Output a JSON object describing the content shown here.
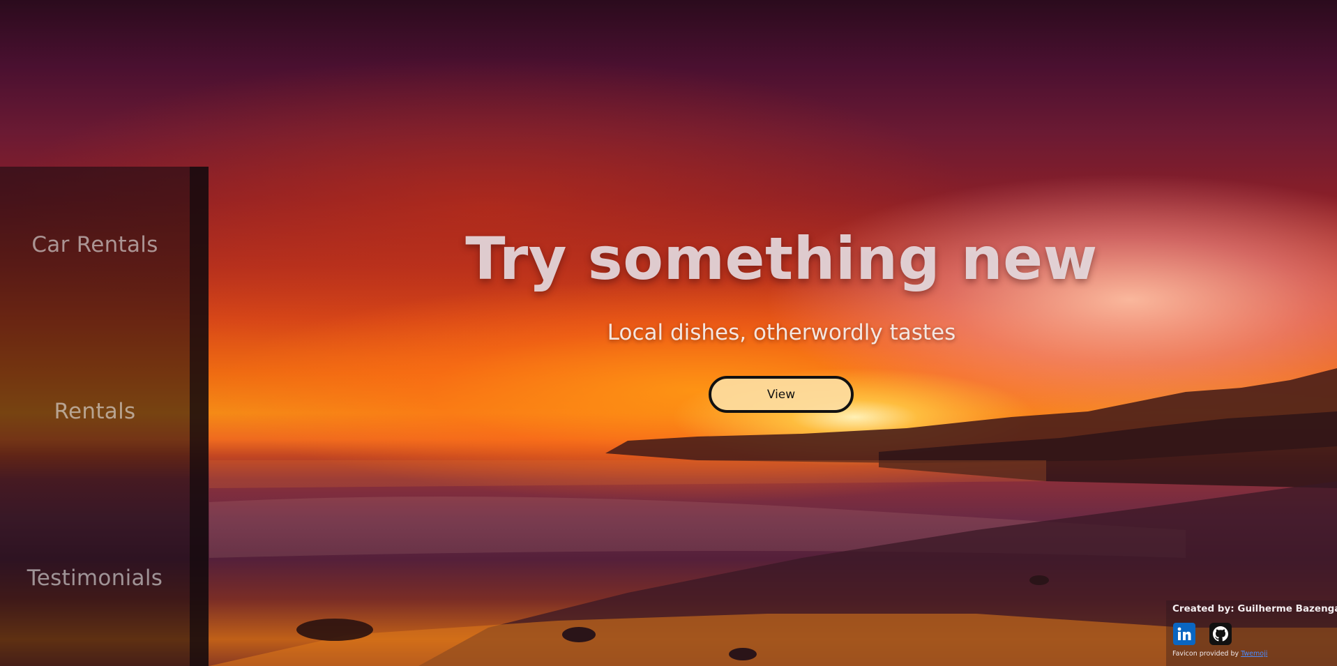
{
  "sidebar": {
    "items": [
      {
        "label": "Car Rentals"
      },
      {
        "label": "Rentals"
      },
      {
        "label": "Testimonials"
      }
    ]
  },
  "hero": {
    "title": "Try something new",
    "subtitle": "Local dishes, otherwordly tastes",
    "button_label": "View"
  },
  "footer": {
    "credit": "Created by: Guilherme Bazenga",
    "favicon_note": "Favicon provided by",
    "favicon_link": "Twemoji",
    "social": [
      {
        "icon": "linkedin-icon"
      },
      {
        "icon": "github-icon"
      }
    ]
  },
  "colors": {
    "button_bg": "#fddca0",
    "button_border": "#111111",
    "linkedin": "#0a66c2",
    "github": "#111111",
    "link": "#4a8cff"
  }
}
